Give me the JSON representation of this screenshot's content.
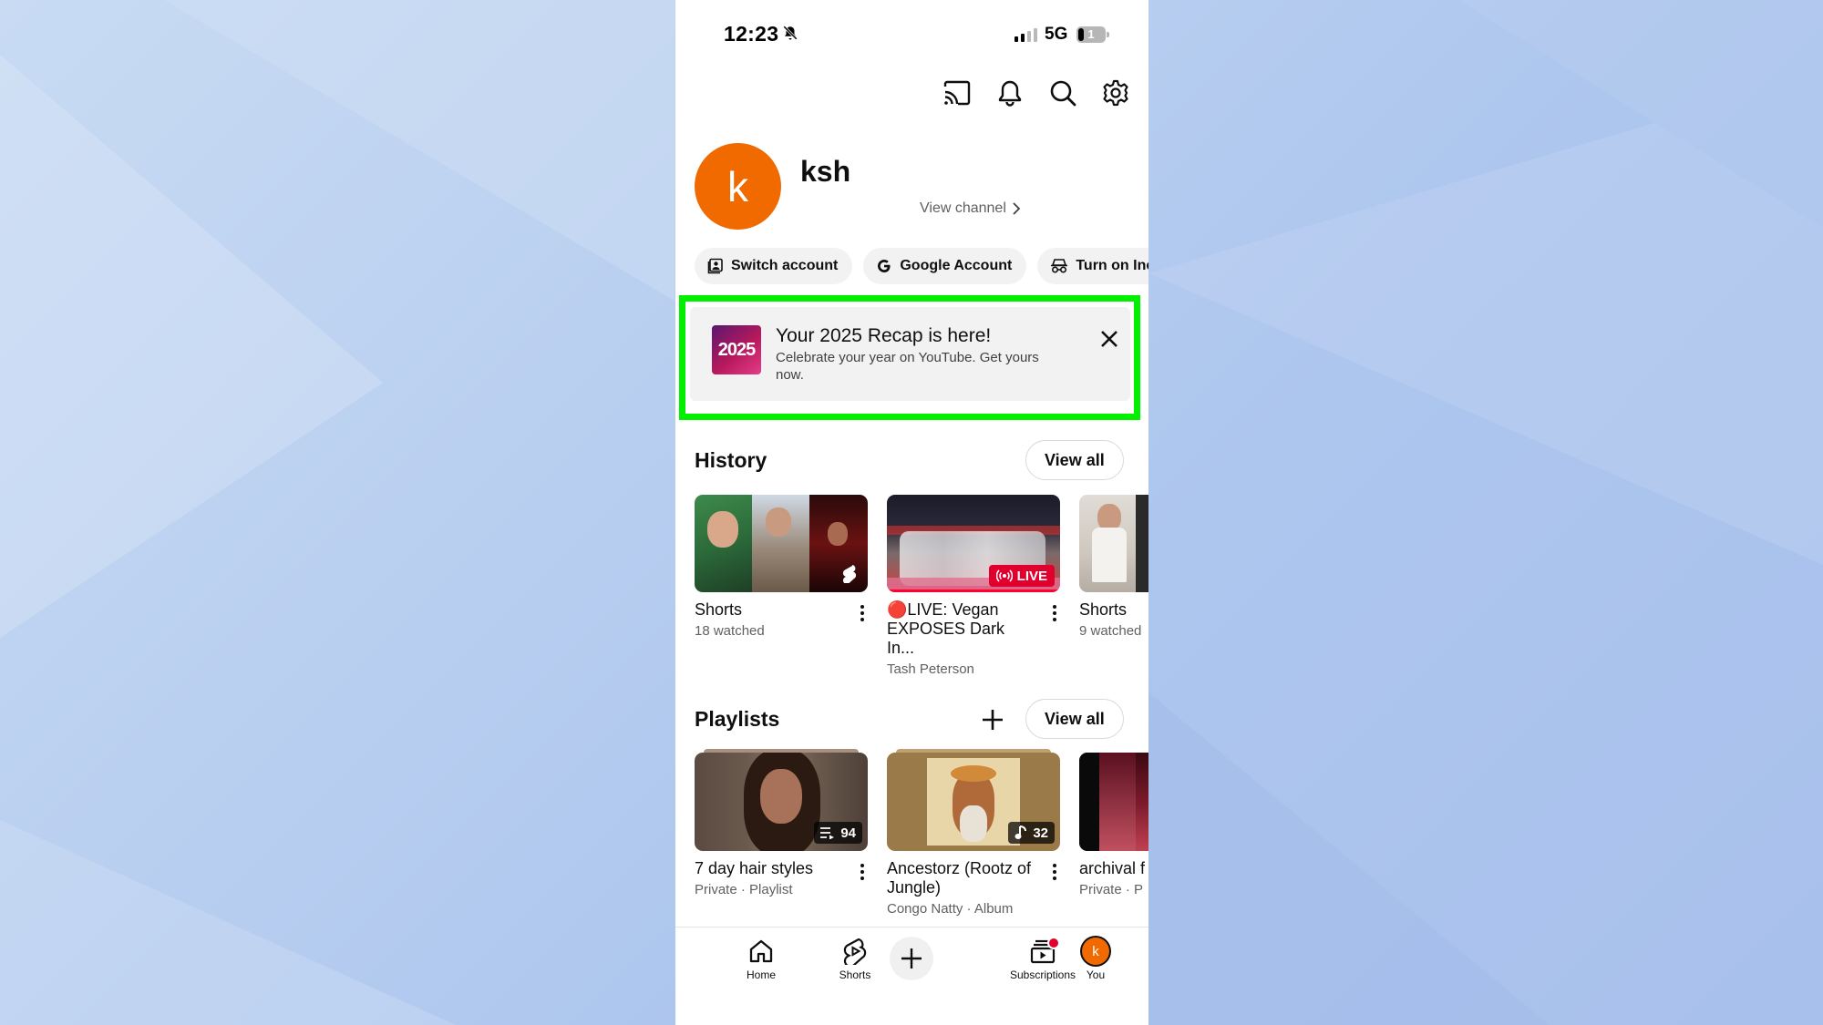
{
  "status_bar": {
    "time": "12:23",
    "network": "5G",
    "battery_level": "1"
  },
  "header_icons": [
    "cast-icon",
    "bell-icon",
    "search-icon",
    "gear-icon"
  ],
  "profile": {
    "avatar_letter": "k",
    "avatar_color": "#f06a00",
    "name": "ksh",
    "view_channel": "View channel"
  },
  "chips": {
    "switch_account": "Switch account",
    "google_account": "Google Account",
    "incognito": "Turn on Inc"
  },
  "recap": {
    "thumb_text": "2025",
    "title": "Your 2025 Recap is here!",
    "subtitle": "Celebrate your year on YouTube. Get yours now."
  },
  "history": {
    "title": "History",
    "view_all": "View all",
    "items": [
      {
        "name": "Shorts",
        "meta": "18 watched"
      },
      {
        "name": "🔴LIVE: Vegan EXPOSES Dark In...",
        "meta": "Tash Peterson",
        "badge": "LIVE"
      },
      {
        "name": "Shorts",
        "meta": "9 watched"
      }
    ]
  },
  "playlists": {
    "title": "Playlists",
    "view_all": "View all",
    "items": [
      {
        "name": "7 day hair styles",
        "meta": "Private · Playlist",
        "count": "94"
      },
      {
        "name": "Ancestorz (Rootz of Jungle)",
        "meta": "Congo Natty · Album",
        "count": "32"
      },
      {
        "name": "archival f",
        "meta": "Private · P"
      }
    ]
  },
  "bottom_nav": {
    "home": "Home",
    "shorts": "Shorts",
    "subscriptions": "Subscriptions",
    "you": "You",
    "you_letter": "k"
  },
  "colors": {
    "highlight": "#00f000",
    "live_red": "#e1002d",
    "avatar": "#f06a00"
  }
}
